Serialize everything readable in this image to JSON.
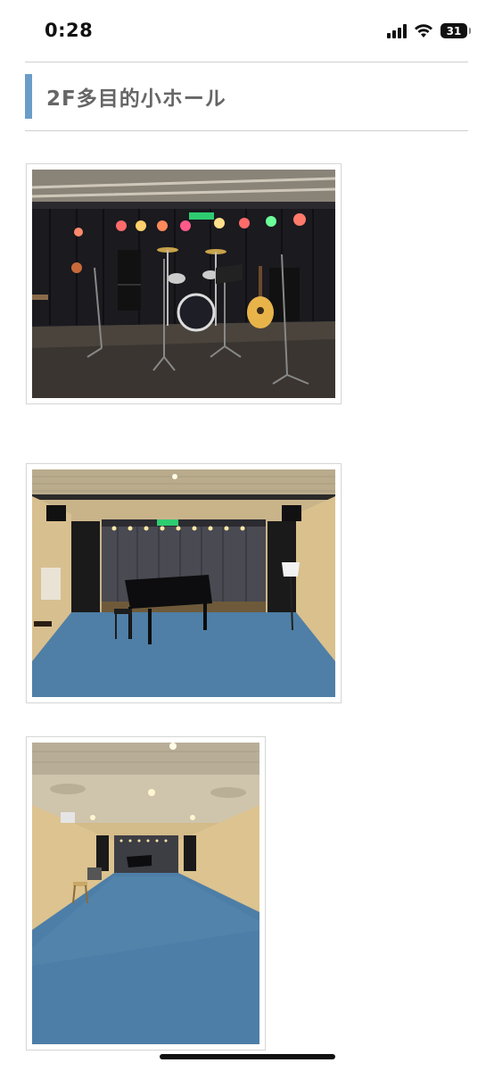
{
  "status_bar": {
    "time": "0:28",
    "battery": "31",
    "icons": [
      "signal-icon",
      "wifi-icon",
      "battery-icon"
    ]
  },
  "section": {
    "title": "2F多目的小ホール",
    "accent_color": "#6a9dc8"
  },
  "photos": [
    {
      "name": "stage-photo",
      "subject": "band stage with drums, guitar, stage lights"
    },
    {
      "name": "hall-piano-photo",
      "subject": "hall with grand piano and blue carpet"
    },
    {
      "name": "hall-long-photo",
      "subject": "long hall view with blue carpet"
    }
  ]
}
